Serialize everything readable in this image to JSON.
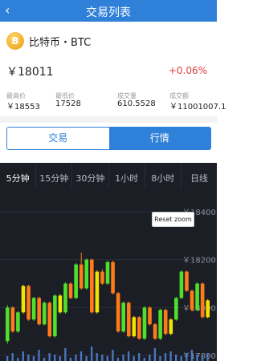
{
  "topbar": {
    "title": "交易列表",
    "back_icon": "chevron-left-icon"
  },
  "coin": {
    "icon_letter": "B",
    "name": "比特币・BTC"
  },
  "price": {
    "last": "￥18011",
    "change": "+0.06%"
  },
  "stats": [
    {
      "label": "最高价",
      "value": "￥18553"
    },
    {
      "label": "最低价",
      "value": "17528"
    },
    {
      "label": "成交量",
      "value": "610.5528"
    },
    {
      "label": "成交额",
      "value": "￥11001007.1"
    }
  ],
  "tabs": {
    "trade": "交易",
    "market": "行情",
    "active": "market"
  },
  "periods": [
    "5分钟",
    "15分钟",
    "30分钟",
    "1小时",
    "8小时",
    "日线"
  ],
  "active_period": "5分钟",
  "reset_zoom": "Reset zoom",
  "chart_data": {
    "type": "candlestick",
    "y_axis_labels": [
      "￥18400",
      "￥18200",
      "￥18000",
      "￥17800"
    ],
    "ylim": [
      17760,
      18410
    ],
    "up_color": "#4fe02c",
    "down_color": "#ff7a1a",
    "highlight_color": "#f2e300",
    "volume_color": "#4a78c4",
    "candles": [
      {
        "o": 17860,
        "c": 18000,
        "h": 18010,
        "l": 17850
      },
      {
        "o": 18000,
        "c": 17900,
        "h": 18005,
        "l": 17895
      },
      {
        "o": 17900,
        "c": 17980,
        "h": 17985,
        "l": 17895
      },
      {
        "o": 17980,
        "c": 18090,
        "h": 18095,
        "l": 17975
      },
      {
        "o": 18090,
        "c": 17950,
        "h": 18095,
        "l": 17945
      },
      {
        "o": 17950,
        "c": 18040,
        "h": 18045,
        "l": 17945
      },
      {
        "o": 18040,
        "c": 17930,
        "h": 18045,
        "l": 17925
      },
      {
        "o": 17930,
        "c": 18020,
        "h": 18025,
        "l": 17925
      },
      {
        "o": 18020,
        "c": 17880,
        "h": 18025,
        "l": 17875
      },
      {
        "o": 17880,
        "c": 18050,
        "h": 18055,
        "l": 17875
      },
      {
        "o": 18050,
        "c": 17980,
        "h": 18055,
        "l": 17975
      },
      {
        "o": 17980,
        "c": 18100,
        "h": 18105,
        "l": 17975
      },
      {
        "o": 18100,
        "c": 18040,
        "h": 18105,
        "l": 18035
      },
      {
        "o": 18040,
        "c": 18180,
        "h": 18185,
        "l": 18035
      },
      {
        "o": 18180,
        "c": 18080,
        "h": 18230,
        "l": 18075
      },
      {
        "o": 18080,
        "c": 18200,
        "h": 18205,
        "l": 18075
      },
      {
        "o": 18200,
        "c": 17980,
        "h": 18205,
        "l": 17975
      },
      {
        "o": 17980,
        "c": 18150,
        "h": 18155,
        "l": 17975
      },
      {
        "o": 18150,
        "c": 18100,
        "h": 18160,
        "l": 18095
      },
      {
        "o": 18100,
        "c": 18190,
        "h": 18195,
        "l": 18095
      },
      {
        "o": 18190,
        "c": 18060,
        "h": 18195,
        "l": 18055
      },
      {
        "o": 18060,
        "c": 17900,
        "h": 18065,
        "l": 17895
      },
      {
        "o": 17900,
        "c": 18020,
        "h": 18025,
        "l": 17895
      },
      {
        "o": 18020,
        "c": 17880,
        "h": 18025,
        "l": 17875
      },
      {
        "o": 17880,
        "c": 17960,
        "h": 17965,
        "l": 17875
      },
      {
        "o": 17960,
        "c": 17870,
        "h": 17965,
        "l": 17865
      },
      {
        "o": 17870,
        "c": 18000,
        "h": 18005,
        "l": 17865
      },
      {
        "o": 18000,
        "c": 17930,
        "h": 18005,
        "l": 17925
      },
      {
        "o": 17930,
        "c": 17870,
        "h": 17935,
        "l": 17865
      },
      {
        "o": 17870,
        "c": 17990,
        "h": 17995,
        "l": 17865
      },
      {
        "o": 17990,
        "c": 17890,
        "h": 17995,
        "l": 17885
      },
      {
        "o": 17890,
        "c": 17950,
        "h": 17955,
        "l": 17885
      },
      {
        "o": 17950,
        "c": 18040,
        "h": 18045,
        "l": 17945
      },
      {
        "o": 18040,
        "c": 18150,
        "h": 18155,
        "l": 18035
      },
      {
        "o": 18150,
        "c": 18070,
        "h": 18155,
        "l": 18065
      },
      {
        "o": 18070,
        "c": 17990,
        "h": 18075,
        "l": 17985
      },
      {
        "o": 17990,
        "c": 18100,
        "h": 18105,
        "l": 17985
      },
      {
        "o": 18100,
        "c": 17960,
        "h": 18105,
        "l": 17955
      },
      {
        "o": 17960,
        "c": 18030,
        "h": 18035,
        "l": 17955
      }
    ],
    "volumes": [
      3,
      5,
      2,
      6,
      4,
      3,
      7,
      2,
      5,
      4,
      3,
      8,
      2,
      4,
      6,
      3,
      9,
      5,
      4,
      3,
      7,
      2,
      4,
      6,
      3,
      5,
      2,
      4,
      8,
      3,
      5,
      6,
      4,
      3,
      5,
      7,
      4,
      3,
      5
    ]
  }
}
